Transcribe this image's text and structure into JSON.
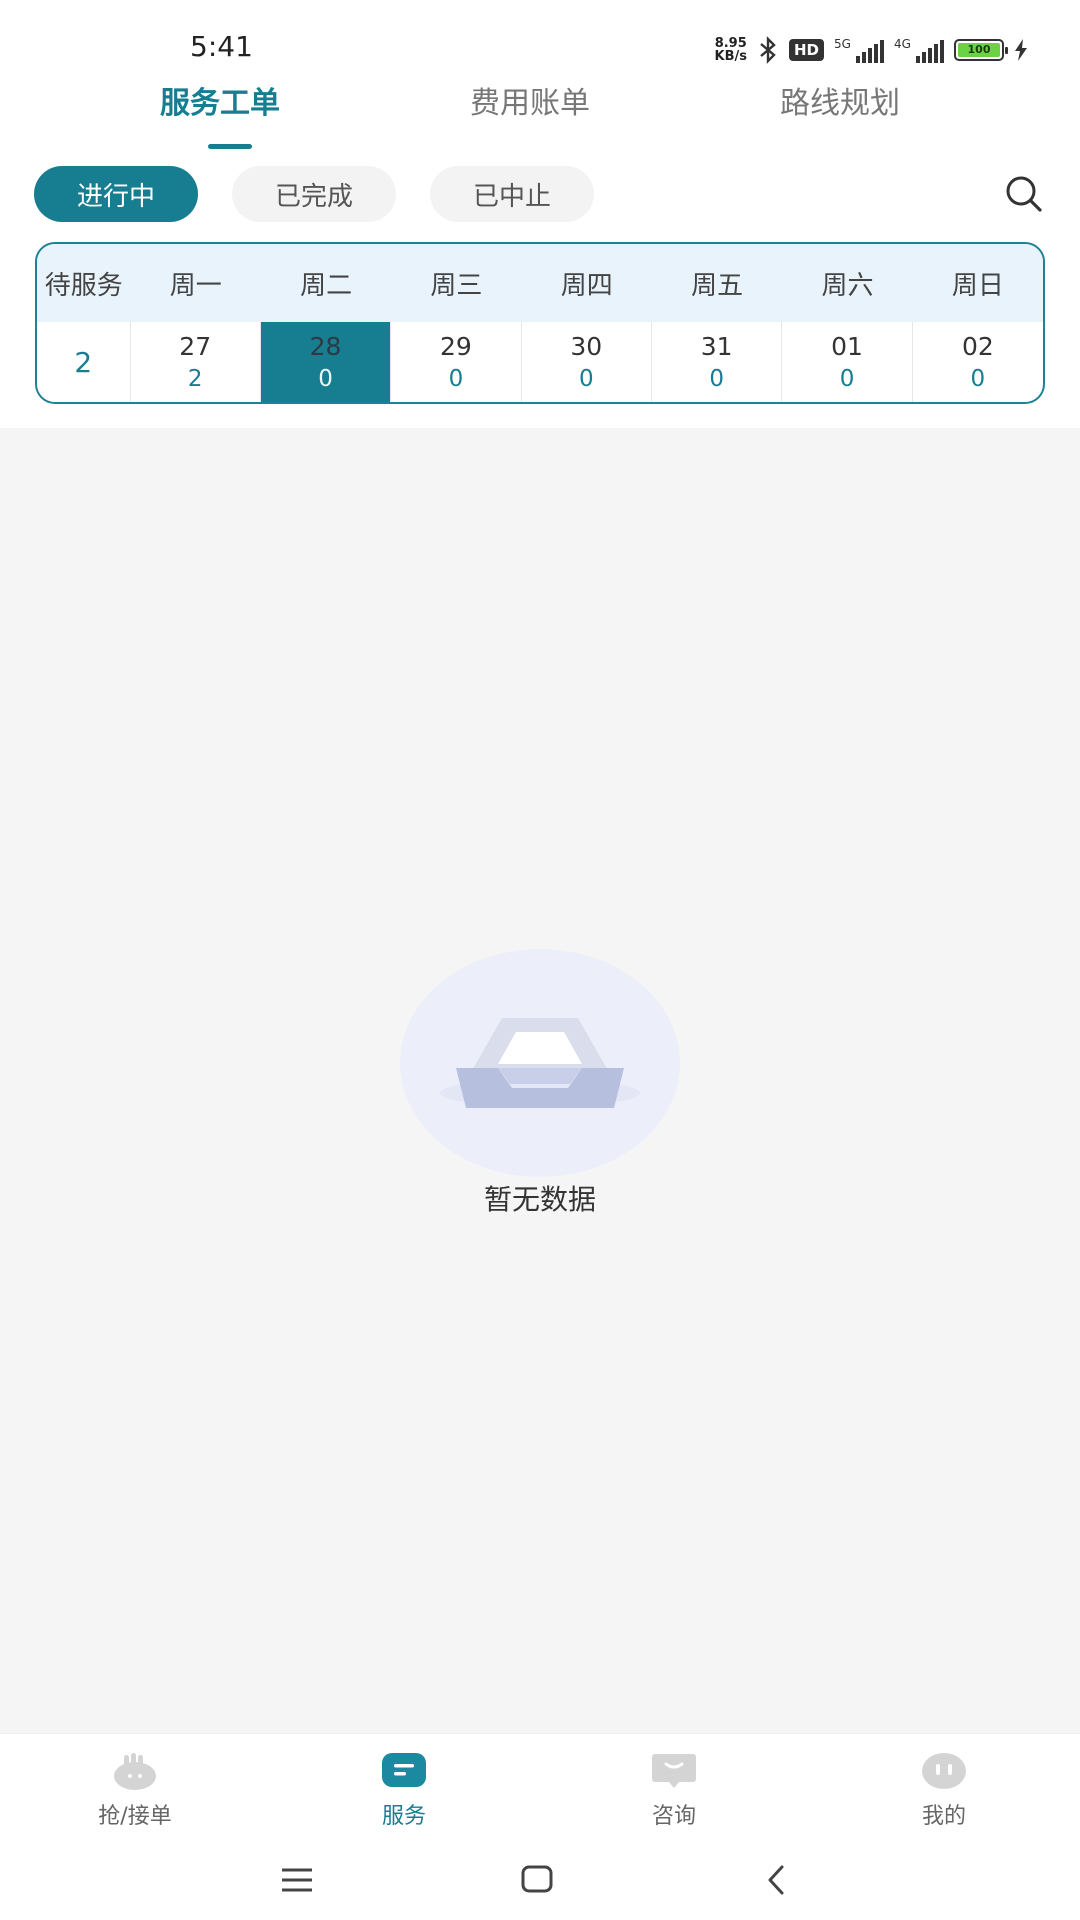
{
  "status_bar": {
    "time": "5:41",
    "net_speed_value": "8.95",
    "net_speed_unit": "KB/s",
    "hd_badge": "HD",
    "signal1_label": "5G",
    "signal2_label": "4G",
    "battery": "100"
  },
  "top_tabs": [
    {
      "label": "服务工单",
      "active": true
    },
    {
      "label": "费用账单",
      "active": false
    },
    {
      "label": "路线规划",
      "active": false
    }
  ],
  "filters": [
    {
      "label": "进行中",
      "active": true
    },
    {
      "label": "已完成",
      "active": false
    },
    {
      "label": "已中止",
      "active": false
    }
  ],
  "calendar": {
    "pending_label": "待服务",
    "pending_count": "2",
    "days": [
      {
        "weekday": "周一",
        "date": "27",
        "count": "2",
        "selected": false
      },
      {
        "weekday": "周二",
        "date": "28",
        "count": "0",
        "selected": true
      },
      {
        "weekday": "周三",
        "date": "29",
        "count": "0",
        "selected": false
      },
      {
        "weekday": "周四",
        "date": "30",
        "count": "0",
        "selected": false
      },
      {
        "weekday": "周五",
        "date": "31",
        "count": "0",
        "selected": false
      },
      {
        "weekday": "周六",
        "date": "01",
        "count": "0",
        "selected": false
      },
      {
        "weekday": "周日",
        "date": "02",
        "count": "0",
        "selected": false
      }
    ]
  },
  "empty_state": {
    "text": "暂无数据",
    "icon": "empty-box-icon"
  },
  "bottom_nav": [
    {
      "label": "抢/接单",
      "icon": "hand-icon",
      "active": false
    },
    {
      "label": "服务",
      "icon": "service-icon",
      "active": true
    },
    {
      "label": "咨询",
      "icon": "chat-icon",
      "active": false
    },
    {
      "label": "我的",
      "icon": "profile-icon",
      "active": false
    }
  ],
  "colors": {
    "accent": "#177d91",
    "background": "#f5f5f5",
    "calendar_header": "#e9f3fb"
  }
}
